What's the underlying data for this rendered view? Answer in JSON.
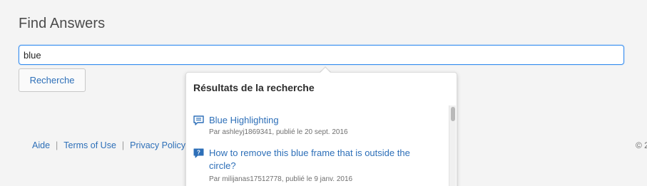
{
  "page": {
    "title": "Find Answers"
  },
  "search": {
    "value": "blue",
    "button_label": "Recherche"
  },
  "footer": {
    "links": [
      "Aide",
      "Terms of Use",
      "Privacy Policy and"
    ],
    "copyright": "© 2"
  },
  "dropdown": {
    "heading": "Résultats de la recherche",
    "results": [
      {
        "icon": "discussion-icon",
        "title": "Blue Highlighting",
        "meta": "Par ashleyj1869341, publié le 20 sept. 2016"
      },
      {
        "icon": "question-icon",
        "title": "How to remove this blue frame that is outside the circle?",
        "meta": "Par milijanas17512778, publié le 9 janv. 2016"
      }
    ]
  },
  "colors": {
    "accent": "#378ef0",
    "link": "#2d6fb8",
    "background": "#f4f4f4"
  }
}
